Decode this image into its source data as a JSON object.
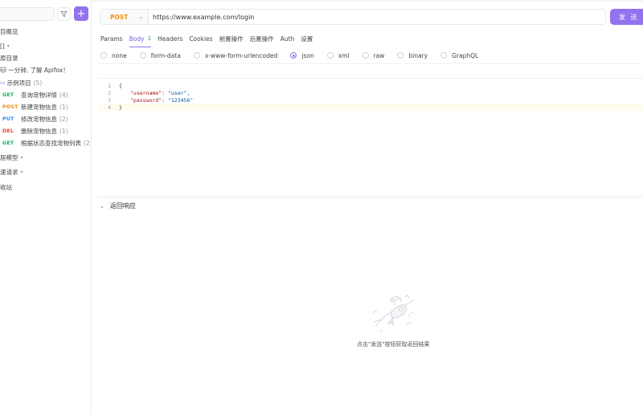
{
  "sidebar": {
    "add_label": "+",
    "rows": [
      {
        "text": "目概览"
      },
      {
        "text": "[]",
        "caret": "▾"
      },
      {
        "text": "原目录"
      },
      {
        "text": "🐱 一分钟, 了解 Apifox！"
      },
      {
        "text": "示例项目",
        "count": "(5)"
      }
    ],
    "endpoints": [
      {
        "method": "GET",
        "name": "查询宠物详情",
        "count": "(4)"
      },
      {
        "method": "POST",
        "name": "新建宠物信息",
        "count": "(1)"
      },
      {
        "method": "PUT",
        "name": "修改宠物信息",
        "count": "(2)"
      },
      {
        "method": "DEL",
        "name": "删除宠物信息",
        "count": "(1)"
      },
      {
        "method": "GET",
        "name": "根据状态查找宠物列表",
        "count": "(2)"
      }
    ],
    "footer_rows": [
      {
        "text": "居模型",
        "caret": "▾"
      },
      {
        "text": "速请求",
        "caret": "▾"
      },
      {
        "text": "收站"
      }
    ]
  },
  "request": {
    "method": "POST",
    "url": "https://www.example.com/login",
    "send_label": "发 送"
  },
  "tabs": [
    {
      "label": "Params"
    },
    {
      "label": "Body",
      "badge": "1"
    },
    {
      "label": "Headers"
    },
    {
      "label": "Cookies"
    },
    {
      "label": "前置操作"
    },
    {
      "label": "后置操作"
    },
    {
      "label": "Auth"
    },
    {
      "label": "设置"
    }
  ],
  "body_types": [
    "none",
    "form-data",
    "x-www-form-urlencoded",
    "json",
    "xml",
    "raw",
    "binary",
    "GraphQL"
  ],
  "selected_body_type": "json",
  "editor": {
    "lines": [
      {
        "no": "1",
        "text": "{"
      },
      {
        "no": "2",
        "key": "\"username\"",
        "value": "\"user\","
      },
      {
        "no": "3",
        "key": "\"password\"",
        "value": "\"123456\""
      },
      {
        "no": "4",
        "text": "}"
      }
    ]
  },
  "response": {
    "title": "返回响应",
    "empty_text": "点击\"发送\"按钮获取返回结果"
  },
  "colors": {
    "accent": "#9373ee",
    "get": "#17b26a",
    "post": "#f79009",
    "put": "#2e90fa",
    "delete": "#f04438"
  }
}
